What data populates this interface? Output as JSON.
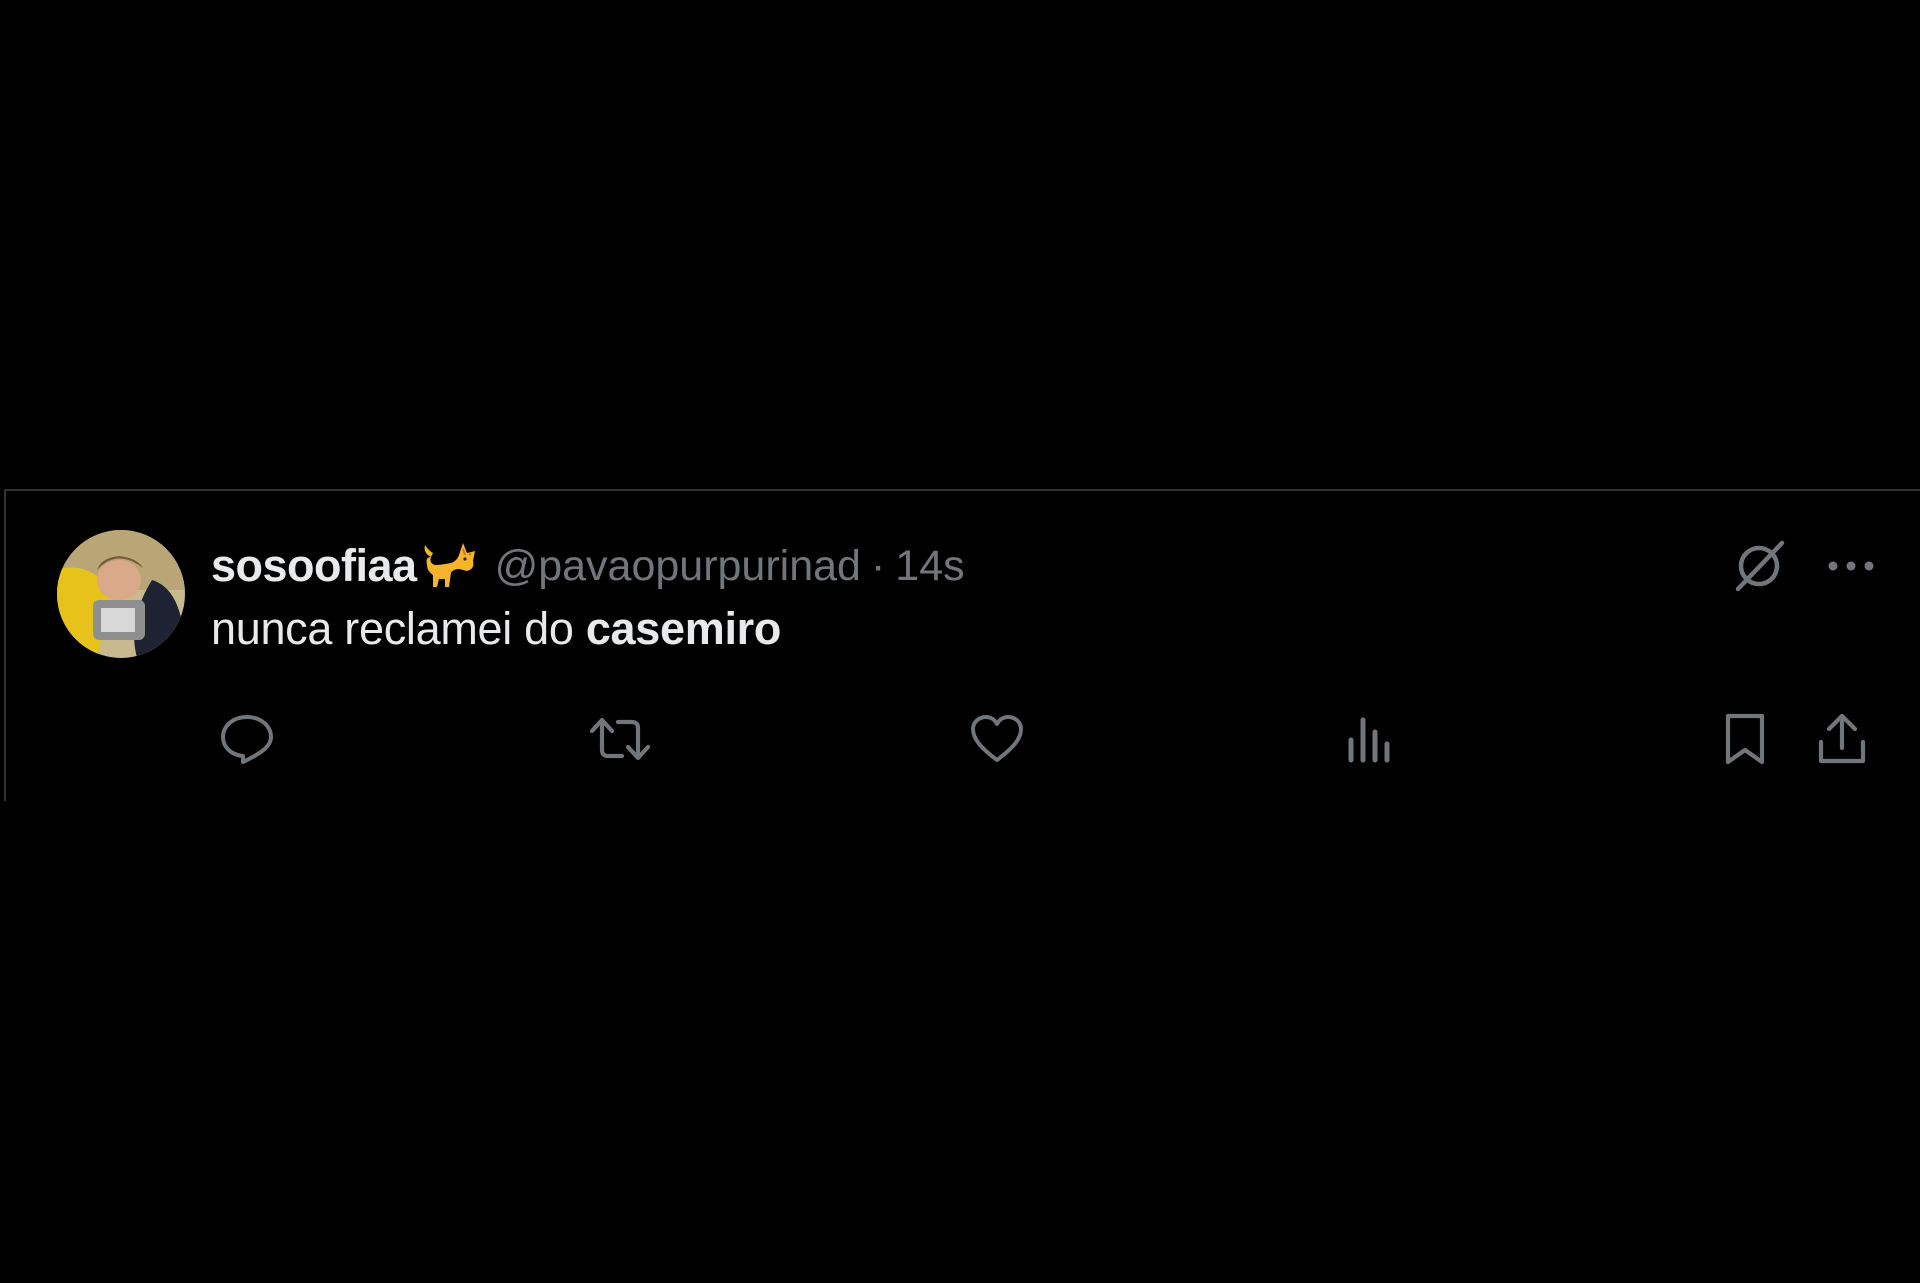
{
  "tweet": {
    "display_name": "sosoofiaa",
    "name_emoji": "cat-emoji",
    "handle": "@pavaopurpurinad",
    "separator": "·",
    "time": "14s",
    "text_plain": "nunca reclamei do ",
    "text_bold": "casemiro"
  },
  "icons": {
    "grok": "grok-icon",
    "more": "more-icon",
    "reply": "reply-icon",
    "retweet": "retweet-icon",
    "like": "like-icon",
    "views": "views-icon",
    "bookmark": "bookmark-icon",
    "share": "share-icon"
  },
  "colors": {
    "background": "#000000",
    "primary_text": "#e7e9ea",
    "secondary_text": "#71767b",
    "border": "#2f3336",
    "icon": "#71767b"
  }
}
